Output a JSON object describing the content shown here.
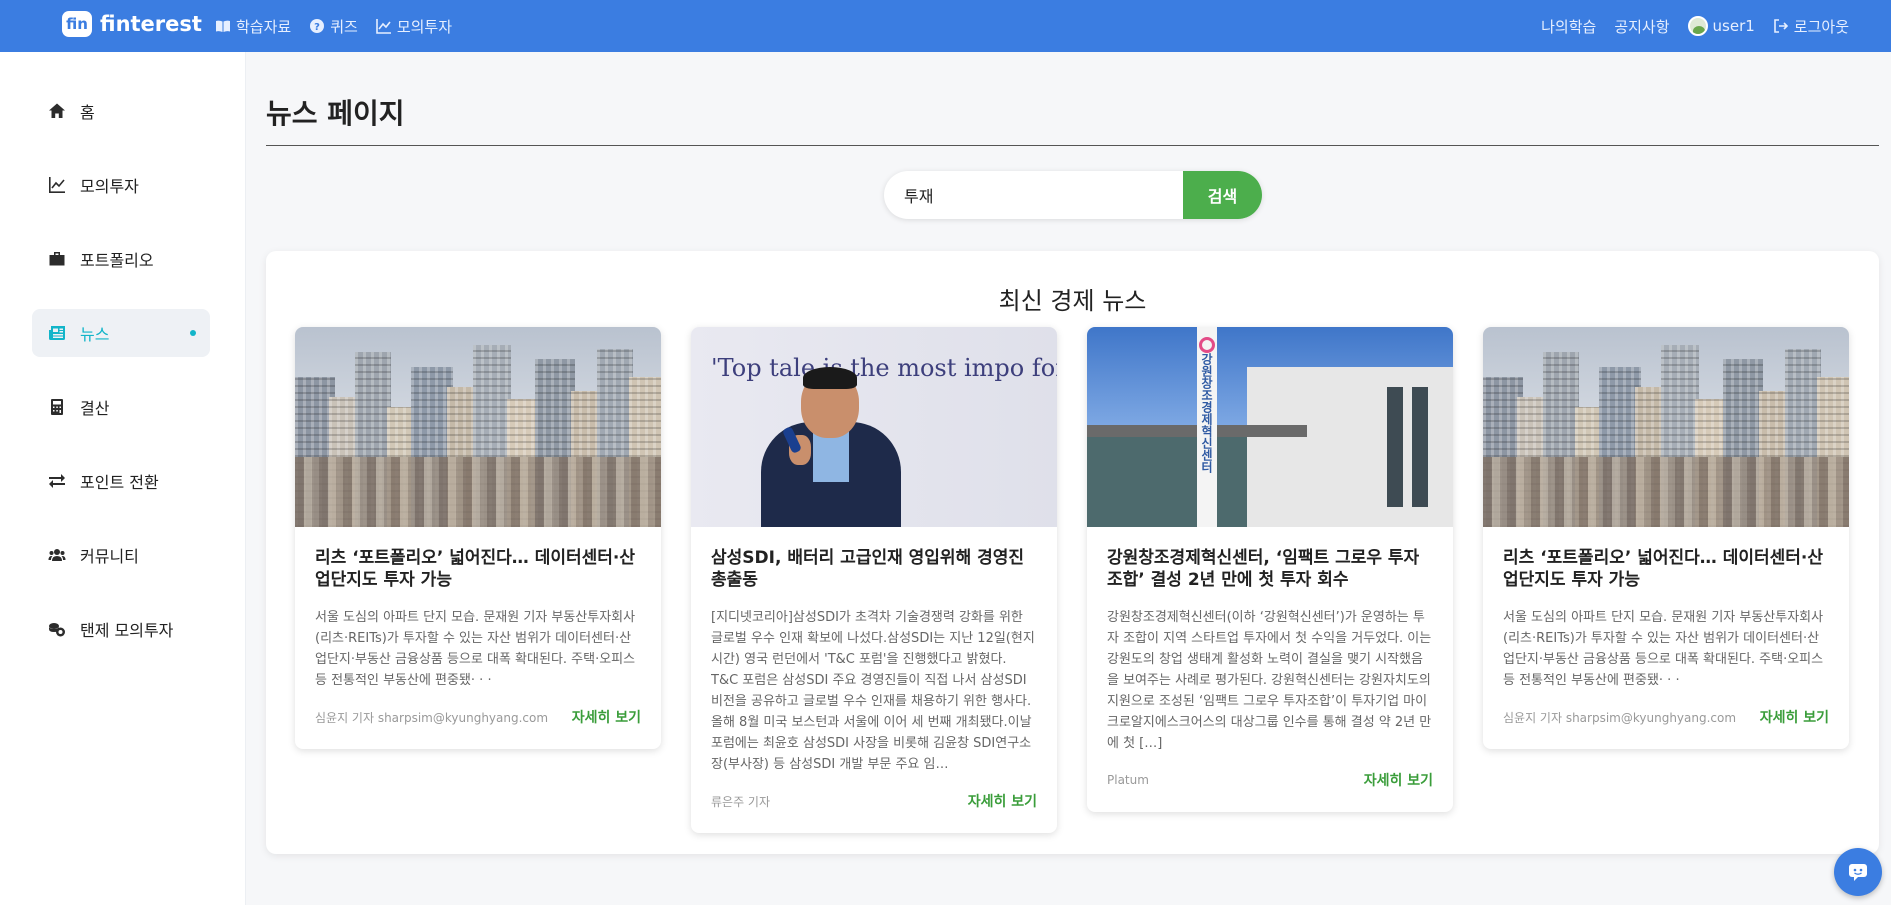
{
  "brand": {
    "badge": "fin",
    "name": "finterest"
  },
  "topnav": {
    "left": [
      {
        "label": "학습자료",
        "icon": "book-icon"
      },
      {
        "label": "퀴즈",
        "icon": "question-icon"
      },
      {
        "label": "모의투자",
        "icon": "chart-line-icon"
      }
    ],
    "right": {
      "my_learning": "나의학습",
      "notice": "공지사항",
      "user": "user1",
      "logout": "로그아웃"
    }
  },
  "sidebar": {
    "items": [
      {
        "label": "홈",
        "icon": "home-icon"
      },
      {
        "label": "모의투자",
        "icon": "chart-line-icon"
      },
      {
        "label": "포트폴리오",
        "icon": "briefcase-icon"
      },
      {
        "label": "뉴스",
        "icon": "newspaper-icon",
        "active": true
      },
      {
        "label": "결산",
        "icon": "calculator-icon"
      },
      {
        "label": "포인트 전환",
        "icon": "exchange-icon"
      },
      {
        "label": "커뮤니티",
        "icon": "users-icon"
      },
      {
        "label": "탠제 모의투자",
        "icon": "coins-icon"
      }
    ]
  },
  "page": {
    "title": "뉴스 페이지"
  },
  "search": {
    "value": "투재",
    "button": "검색"
  },
  "news": {
    "heading": "최신 경제 뉴스",
    "more_label": "자세히 보기",
    "cards": [
      {
        "title": "리츠 ‘포트폴리오’ 넓어진다… 데이터센터·산업단지도 투자 가능",
        "desc": "서울 도심의 아파트 단지 모습. 문재원 기자 부동산투자회사(리츠·REITs)가 투자할 수 있는 자산 범위가 데이터센터·산업단지·부동산 금융상품 등으로 대폭 확대된다. 주택·오피스 등 전통적인 부동산에 편중됐· · ·",
        "author": "심윤지 기자 sharpsim@kyunghyang.com",
        "image": "city-apartments"
      },
      {
        "title": "삼성SDI, 배터리 고급인재 영입위해 경영진 총출동",
        "desc": "[지디넷코리아]삼성SDI가 초격차 기술경쟁력 강화를 위한 글로벌 우수 인재 확보에 나섰다.삼성SDI는 지난 12일(현지시간) 영국 런던에서 'T&C 포럼'을 진행했다고 밝혔다. T&C 포럼은 삼성SDI 주요 경영진들이 직접 나서 삼성SDI 비전을 공유하고 글로벌 우수 인재를 채용하기 위한 행사다. 올해 8월 미국 보스턴과 서울에 이어 세 번째 개최됐다.이날 포럼에는 최윤호 삼성SDI 사장을 비롯해 김윤창 SDI연구소장(부사장) 등 삼성SDI 개발 부문 주요 임…",
        "author": "류은주 기자",
        "image": "speaker-banner",
        "banner": "'Top tale   is the most impo   for   l's growth and f"
      },
      {
        "title": "강원창조경제혁신센터, ‘임팩트 그로우 투자조합’ 결성 2년 만에 첫 투자 회수",
        "desc": "강원창조경제혁신센터(이하 ‘강원혁신센터’)가 운영하는 투자 조합이 지역 스타트업 투자에서 첫 수익을 거두었다. 이는 강원도의 창업 생태계 활성화 노력이 결실을 맺기 시작했음을 보여주는 사례로 평가된다. 강원혁신센터는 강원자치도의 지원으로 조성된 ‘임팩트 그로우 투자조합’이 투자기업 마이크로알지에스크어스의 대상그룹 인수를 통해 결성 약 2년 만에 첫 […]",
        "author": "Platum",
        "image": "center-building",
        "sign": "강원창조경제혁신센터"
      },
      {
        "title": "리츠 ‘포트폴리오’ 넓어진다… 데이터센터·산업단지도 투자 가능",
        "desc": "서울 도심의 아파트 단지 모습. 문재원 기자 부동산투자회사(리츠·REITs)가 투자할 수 있는 자산 범위가 데이터센터·산업단지·부동산 금융상품 등으로 대폭 확대된다. 주택·오피스 등 전통적인 부동산에 편중됐· · ·",
        "author": "심윤지 기자 sharpsim@kyunghyang.com",
        "image": "city-apartments"
      }
    ]
  },
  "chat": {
    "icon": "chat-icon"
  },
  "colors": {
    "primary": "#3b7de1",
    "accent": "#12b5c9",
    "success": "#4cae4c"
  }
}
